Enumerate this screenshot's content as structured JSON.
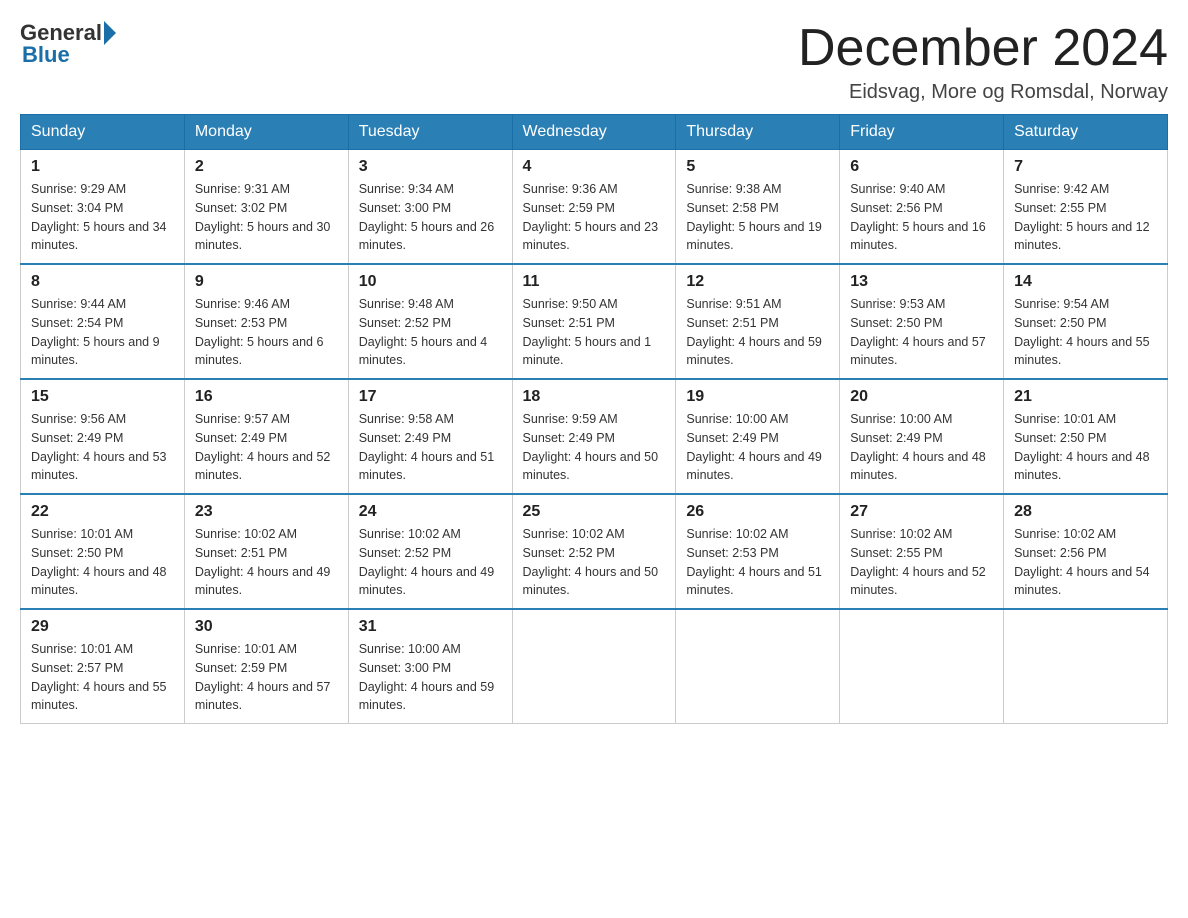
{
  "header": {
    "logo_general": "General",
    "logo_blue": "Blue",
    "month_title": "December 2024",
    "location": "Eidsvag, More og Romsdal, Norway"
  },
  "weekdays": [
    "Sunday",
    "Monday",
    "Tuesday",
    "Wednesday",
    "Thursday",
    "Friday",
    "Saturday"
  ],
  "weeks": [
    {
      "days": [
        {
          "num": "1",
          "sunrise": "9:29 AM",
          "sunset": "3:04 PM",
          "daylight": "5 hours and 34 minutes."
        },
        {
          "num": "2",
          "sunrise": "9:31 AM",
          "sunset": "3:02 PM",
          "daylight": "5 hours and 30 minutes."
        },
        {
          "num": "3",
          "sunrise": "9:34 AM",
          "sunset": "3:00 PM",
          "daylight": "5 hours and 26 minutes."
        },
        {
          "num": "4",
          "sunrise": "9:36 AM",
          "sunset": "2:59 PM",
          "daylight": "5 hours and 23 minutes."
        },
        {
          "num": "5",
          "sunrise": "9:38 AM",
          "sunset": "2:58 PM",
          "daylight": "5 hours and 19 minutes."
        },
        {
          "num": "6",
          "sunrise": "9:40 AM",
          "sunset": "2:56 PM",
          "daylight": "5 hours and 16 minutes."
        },
        {
          "num": "7",
          "sunrise": "9:42 AM",
          "sunset": "2:55 PM",
          "daylight": "5 hours and 12 minutes."
        }
      ]
    },
    {
      "days": [
        {
          "num": "8",
          "sunrise": "9:44 AM",
          "sunset": "2:54 PM",
          "daylight": "5 hours and 9 minutes."
        },
        {
          "num": "9",
          "sunrise": "9:46 AM",
          "sunset": "2:53 PM",
          "daylight": "5 hours and 6 minutes."
        },
        {
          "num": "10",
          "sunrise": "9:48 AM",
          "sunset": "2:52 PM",
          "daylight": "5 hours and 4 minutes."
        },
        {
          "num": "11",
          "sunrise": "9:50 AM",
          "sunset": "2:51 PM",
          "daylight": "5 hours and 1 minute."
        },
        {
          "num": "12",
          "sunrise": "9:51 AM",
          "sunset": "2:51 PM",
          "daylight": "4 hours and 59 minutes."
        },
        {
          "num": "13",
          "sunrise": "9:53 AM",
          "sunset": "2:50 PM",
          "daylight": "4 hours and 57 minutes."
        },
        {
          "num": "14",
          "sunrise": "9:54 AM",
          "sunset": "2:50 PM",
          "daylight": "4 hours and 55 minutes."
        }
      ]
    },
    {
      "days": [
        {
          "num": "15",
          "sunrise": "9:56 AM",
          "sunset": "2:49 PM",
          "daylight": "4 hours and 53 minutes."
        },
        {
          "num": "16",
          "sunrise": "9:57 AM",
          "sunset": "2:49 PM",
          "daylight": "4 hours and 52 minutes."
        },
        {
          "num": "17",
          "sunrise": "9:58 AM",
          "sunset": "2:49 PM",
          "daylight": "4 hours and 51 minutes."
        },
        {
          "num": "18",
          "sunrise": "9:59 AM",
          "sunset": "2:49 PM",
          "daylight": "4 hours and 50 minutes."
        },
        {
          "num": "19",
          "sunrise": "10:00 AM",
          "sunset": "2:49 PM",
          "daylight": "4 hours and 49 minutes."
        },
        {
          "num": "20",
          "sunrise": "10:00 AM",
          "sunset": "2:49 PM",
          "daylight": "4 hours and 48 minutes."
        },
        {
          "num": "21",
          "sunrise": "10:01 AM",
          "sunset": "2:50 PM",
          "daylight": "4 hours and 48 minutes."
        }
      ]
    },
    {
      "days": [
        {
          "num": "22",
          "sunrise": "10:01 AM",
          "sunset": "2:50 PM",
          "daylight": "4 hours and 48 minutes."
        },
        {
          "num": "23",
          "sunrise": "10:02 AM",
          "sunset": "2:51 PM",
          "daylight": "4 hours and 49 minutes."
        },
        {
          "num": "24",
          "sunrise": "10:02 AM",
          "sunset": "2:52 PM",
          "daylight": "4 hours and 49 minutes."
        },
        {
          "num": "25",
          "sunrise": "10:02 AM",
          "sunset": "2:52 PM",
          "daylight": "4 hours and 50 minutes."
        },
        {
          "num": "26",
          "sunrise": "10:02 AM",
          "sunset": "2:53 PM",
          "daylight": "4 hours and 51 minutes."
        },
        {
          "num": "27",
          "sunrise": "10:02 AM",
          "sunset": "2:55 PM",
          "daylight": "4 hours and 52 minutes."
        },
        {
          "num": "28",
          "sunrise": "10:02 AM",
          "sunset": "2:56 PM",
          "daylight": "4 hours and 54 minutes."
        }
      ]
    },
    {
      "days": [
        {
          "num": "29",
          "sunrise": "10:01 AM",
          "sunset": "2:57 PM",
          "daylight": "4 hours and 55 minutes."
        },
        {
          "num": "30",
          "sunrise": "10:01 AM",
          "sunset": "2:59 PM",
          "daylight": "4 hours and 57 minutes."
        },
        {
          "num": "31",
          "sunrise": "10:00 AM",
          "sunset": "3:00 PM",
          "daylight": "4 hours and 59 minutes."
        },
        null,
        null,
        null,
        null
      ]
    }
  ],
  "labels": {
    "sunrise": "Sunrise:",
    "sunset": "Sunset:",
    "daylight": "Daylight:"
  }
}
